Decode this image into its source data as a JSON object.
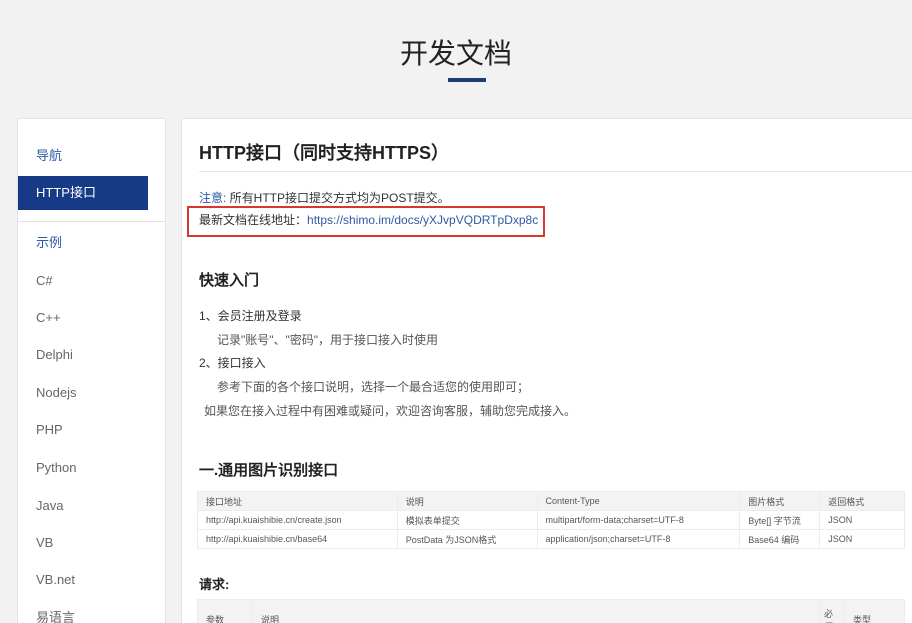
{
  "header": {
    "title": "开发文档"
  },
  "sidebar": {
    "items": [
      {
        "label": "导航",
        "type": "section"
      },
      {
        "label": "HTTP接口",
        "type": "active"
      },
      {
        "label": "示例",
        "type": "section"
      },
      {
        "label": "C#",
        "type": "item"
      },
      {
        "label": "C++",
        "type": "item"
      },
      {
        "label": "Delphi",
        "type": "item"
      },
      {
        "label": "Nodejs",
        "type": "item"
      },
      {
        "label": "PHP",
        "type": "item"
      },
      {
        "label": "Python",
        "type": "item"
      },
      {
        "label": "Java",
        "type": "item"
      },
      {
        "label": "VB",
        "type": "item"
      },
      {
        "label": "VB.net",
        "type": "item"
      },
      {
        "label": "易语言",
        "type": "item"
      }
    ]
  },
  "main": {
    "title": "HTTP接口（同时支持HTTPS）",
    "notice_label": "注意:",
    "notice_text": " 所有HTTP接口提交方式均为POST提交。",
    "doc_label": "最新文档在线地址：",
    "doc_url": "https://shimo.im/docs/yXJvpVQDRTpDxp8c",
    "quickstart": {
      "title": "快速入门",
      "step1": "1、会员注册及登录",
      "step1_detail": "记录\"账号\"、\"密码\"，用于接口接入时使用",
      "step2": "2、接口接入",
      "step2_detail1": "参考下面的各个接口说明，选择一个最合适您的使用即可；",
      "step2_detail2": "如果您在接入过程中有困难或疑问，欢迎咨询客服，辅助您完成接入。"
    },
    "section1": {
      "title": "一.通用图片识别接口",
      "headers": [
        "接口地址",
        "说明",
        "Content-Type",
        "图片格式",
        "返回格式"
      ],
      "rows": [
        [
          "http://api.kuaishibie.cn/create.json",
          "模拟表单提交",
          "multipart/form-data;charset=UTF-8",
          "Byte[] 字节流",
          "JSON"
        ],
        [
          "http://api.kuaishibie.cn/base64",
          "PostData 为JSON格式",
          "application/json;charset=UTF-8",
          "Base64 编码",
          "JSON"
        ]
      ]
    },
    "request": {
      "title": "请求:",
      "headers": [
        "参数",
        "说明",
        "必须",
        "类型"
      ]
    }
  }
}
